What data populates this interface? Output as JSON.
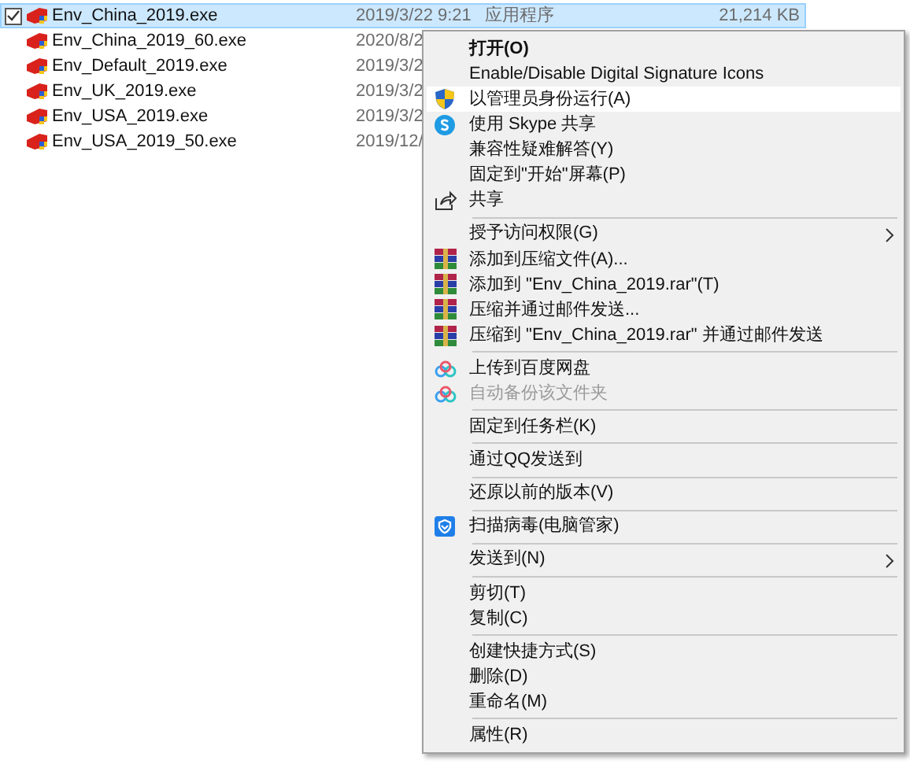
{
  "files": [
    {
      "name": "Env_China_2019.exe",
      "date": "2019/3/22 9:21",
      "type": "应用程序",
      "size": "21,214 KB",
      "selected": true,
      "checked": true
    },
    {
      "name": "Env_China_2019_60.exe",
      "date": "2020/8/2",
      "selected": false,
      "checked": false
    },
    {
      "name": "Env_Default_2019.exe",
      "date": "2019/3/2",
      "selected": false,
      "checked": false
    },
    {
      "name": "Env_UK_2019.exe",
      "date": "2019/3/2",
      "selected": false,
      "checked": false
    },
    {
      "name": "Env_USA_2019.exe",
      "date": "2019/3/2",
      "selected": false,
      "checked": false
    },
    {
      "name": "Env_USA_2019_50.exe",
      "date": "2019/12/",
      "selected": false,
      "checked": false
    }
  ],
  "context_menu": [
    {
      "kind": "item",
      "label": "打开(O)",
      "bold": true,
      "selected": false
    },
    {
      "kind": "item",
      "label": "Enable/Disable Digital Signature Icons",
      "selected": false
    },
    {
      "kind": "shield",
      "label": "以管理员身份运行(A)",
      "selected": true
    },
    {
      "kind": "skype",
      "label": "使用 Skype 共享",
      "selected": false
    },
    {
      "kind": "item",
      "label": "兼容性疑难解答(Y)",
      "selected": false
    },
    {
      "kind": "item",
      "label": "固定到\"开始\"屏幕(P)",
      "selected": false
    },
    {
      "kind": "share",
      "label": "共享",
      "selected": false
    },
    {
      "kind": "separator"
    },
    {
      "kind": "item",
      "label": "授予访问权限(G)",
      "submenu": true,
      "selected": false
    },
    {
      "kind": "archive",
      "label": "添加到压缩文件(A)...",
      "selected": false
    },
    {
      "kind": "archive",
      "label": "添加到 \"Env_China_2019.rar\"(T)",
      "selected": false
    },
    {
      "kind": "archive",
      "label": "压缩并通过邮件发送...",
      "selected": false
    },
    {
      "kind": "archive",
      "label": "压缩到 \"Env_China_2019.rar\" 并通过邮件发送",
      "selected": false
    },
    {
      "kind": "separator"
    },
    {
      "kind": "cloud",
      "label": "上传到百度网盘",
      "selected": false
    },
    {
      "kind": "cloud",
      "label": "自动备份该文件夹",
      "disabled": true,
      "selected": false
    },
    {
      "kind": "separator"
    },
    {
      "kind": "item",
      "label": "固定到任务栏(K)",
      "selected": false
    },
    {
      "kind": "separator"
    },
    {
      "kind": "item",
      "label": "通过QQ发送到",
      "selected": false
    },
    {
      "kind": "separator"
    },
    {
      "kind": "item",
      "label": "还原以前的版本(V)",
      "selected": false
    },
    {
      "kind": "separator"
    },
    {
      "kind": "guard",
      "label": "扫描病毒(电脑管家)",
      "selected": false
    },
    {
      "kind": "separator"
    },
    {
      "kind": "item",
      "label": "发送到(N)",
      "submenu": true,
      "selected": false
    },
    {
      "kind": "separator"
    },
    {
      "kind": "item",
      "label": "剪切(T)",
      "selected": false
    },
    {
      "kind": "item",
      "label": "复制(C)",
      "selected": false
    },
    {
      "kind": "separator"
    },
    {
      "kind": "item",
      "label": "创建快捷方式(S)",
      "selected": false
    },
    {
      "kind": "item",
      "label": "删除(D)",
      "selected": false
    },
    {
      "kind": "item",
      "label": "重命名(M)",
      "selected": false
    },
    {
      "kind": "separator"
    },
    {
      "kind": "item",
      "label": "属性(R)",
      "selected": false
    }
  ]
}
